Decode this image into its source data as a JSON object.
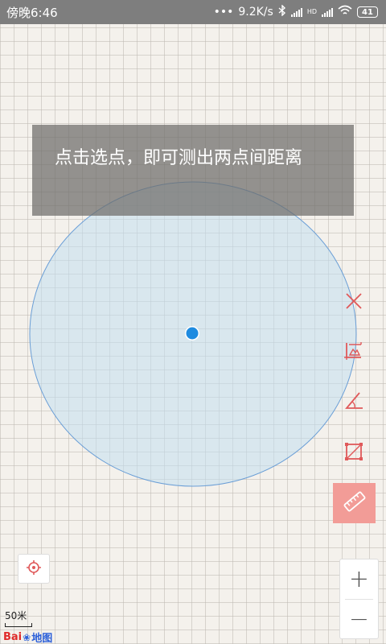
{
  "status_bar": {
    "time": "傍晚6:46",
    "network_speed": "9.2K/s",
    "network_type": "HD",
    "battery": "41"
  },
  "toast": {
    "text": "点击选点，即可测出两点间距离"
  },
  "tools": {
    "clear": "close-icon",
    "area": "area-measure-icon",
    "angle": "angle-measure-icon",
    "rect": "rectangle-measure-icon",
    "ruler": "ruler-icon"
  },
  "zoom": {
    "in_label": "+",
    "out_label": "−"
  },
  "scale": {
    "label": "50米"
  },
  "logo": {
    "part1": "Bai",
    "part2": "地图"
  },
  "colors": {
    "accent": "#e0595a",
    "ruler_active": "#f29c97",
    "circle_fill": "#cfe2f0",
    "circle_stroke": "#6a9ed6",
    "center_dot": "#1e8be0"
  }
}
